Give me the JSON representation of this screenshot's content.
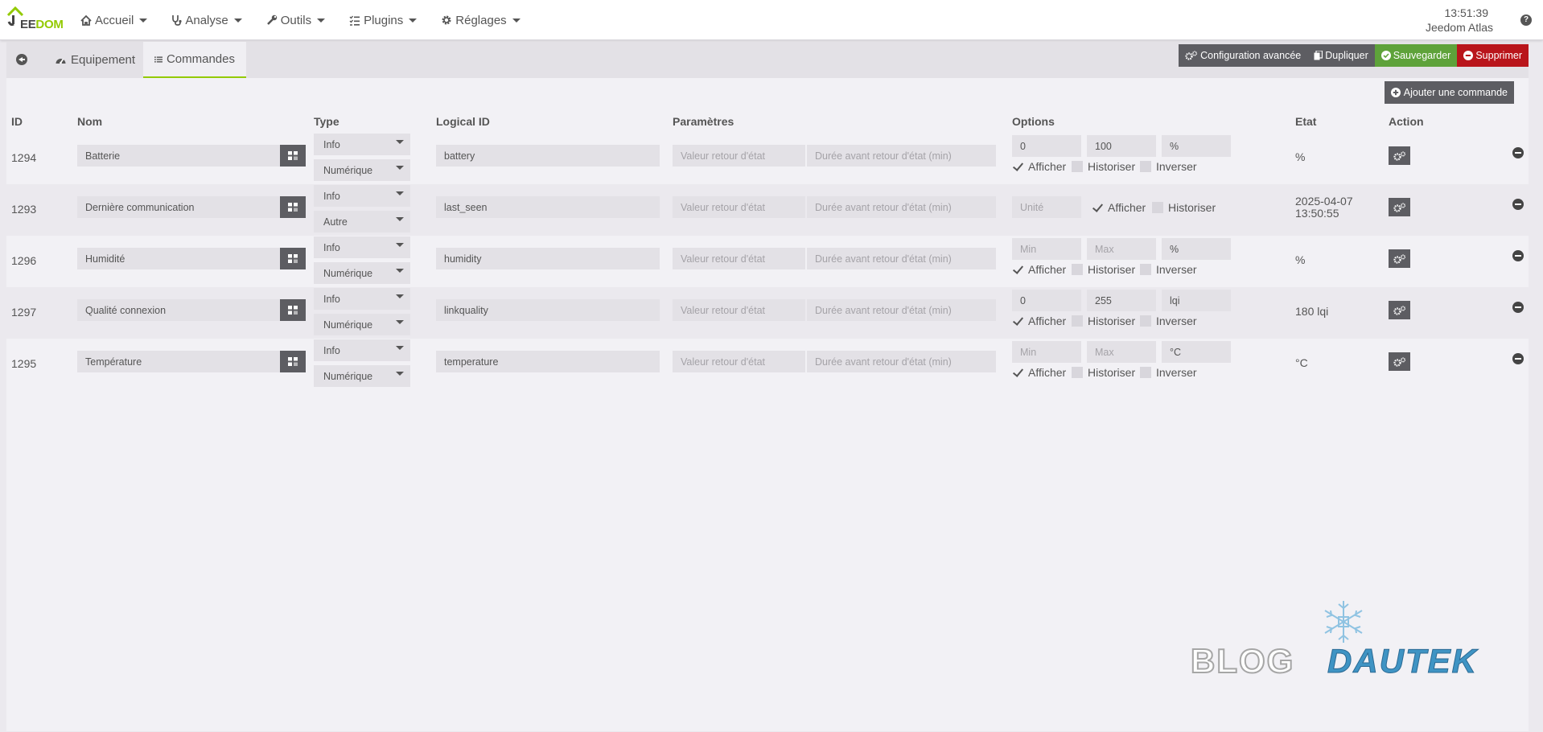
{
  "navbar": {
    "logo_prefix": "J",
    "logo_main": "EE",
    "logo_suffix": "DOM",
    "menu": [
      {
        "label": "Accueil",
        "icon": "home-icon"
      },
      {
        "label": "Analyse",
        "icon": "stethoscope-icon"
      },
      {
        "label": "Outils",
        "icon": "wrench-icon"
      },
      {
        "label": "Plugins",
        "icon": "tasks-icon"
      },
      {
        "label": "Réglages",
        "icon": "cog-icon"
      }
    ],
    "time": "13:51:39",
    "system_name": "Jeedom Atlas",
    "help_label": "?"
  },
  "tabs": {
    "equipement": "Equipement",
    "commandes": "Commandes"
  },
  "actions": {
    "config_avancee": "Configuration avancée",
    "dupliquer": "Dupliquer",
    "sauvegarder": "Sauvegarder",
    "supprimer": "Supprimer"
  },
  "add_command": "Ajouter une commande",
  "table": {
    "headers": [
      "ID",
      "Nom",
      "Type",
      "Logical ID",
      "Paramètres",
      "Options",
      "Etat",
      "Action"
    ],
    "placeholders": {
      "valeur_retour": "Valeur retour d'état",
      "duree_retour": "Durée avant retour d'état (min)"
    },
    "option_labels": {
      "afficher": "Afficher",
      "historiser": "Historiser",
      "inverser": "Inverser"
    },
    "rows": [
      {
        "id": "1294",
        "name": "Batterie",
        "type": "Info",
        "subtype": "Numérique",
        "logical_id": "battery",
        "min": "0",
        "min_ph": false,
        "max": "100",
        "max_ph": false,
        "unit": "%",
        "unit_ph": false,
        "etat": "%",
        "etat2": ""
      },
      {
        "id": "1293",
        "name": "Dernière communication",
        "type": "Info",
        "subtype": "Autre",
        "logical_id": "last_seen",
        "unit_only": "Unité",
        "etat": "2025-04-07",
        "etat2": "13:50:55"
      },
      {
        "id": "1296",
        "name": "Humidité",
        "type": "Info",
        "subtype": "Numérique",
        "logical_id": "humidity",
        "min": "Min",
        "min_ph": true,
        "max": "Max",
        "max_ph": true,
        "unit": "%",
        "unit_ph": false,
        "etat": "%",
        "etat2": ""
      },
      {
        "id": "1297",
        "name": "Qualité connexion",
        "type": "Info",
        "subtype": "Numérique",
        "logical_id": "linkquality",
        "min": "0",
        "min_ph": false,
        "max": "255",
        "max_ph": false,
        "unit": "lqi",
        "unit_ph": false,
        "etat": "180 lqi",
        "etat2": ""
      },
      {
        "id": "1295",
        "name": "Température",
        "type": "Info",
        "subtype": "Numérique",
        "logical_id": "temperature",
        "min": "Min",
        "min_ph": true,
        "max": "Max",
        "max_ph": true,
        "unit": "°C",
        "unit_ph": false,
        "etat": "°C",
        "etat2": ""
      }
    ]
  },
  "watermark": {
    "part1": "BLOG",
    "part2": "DAUTEK"
  }
}
